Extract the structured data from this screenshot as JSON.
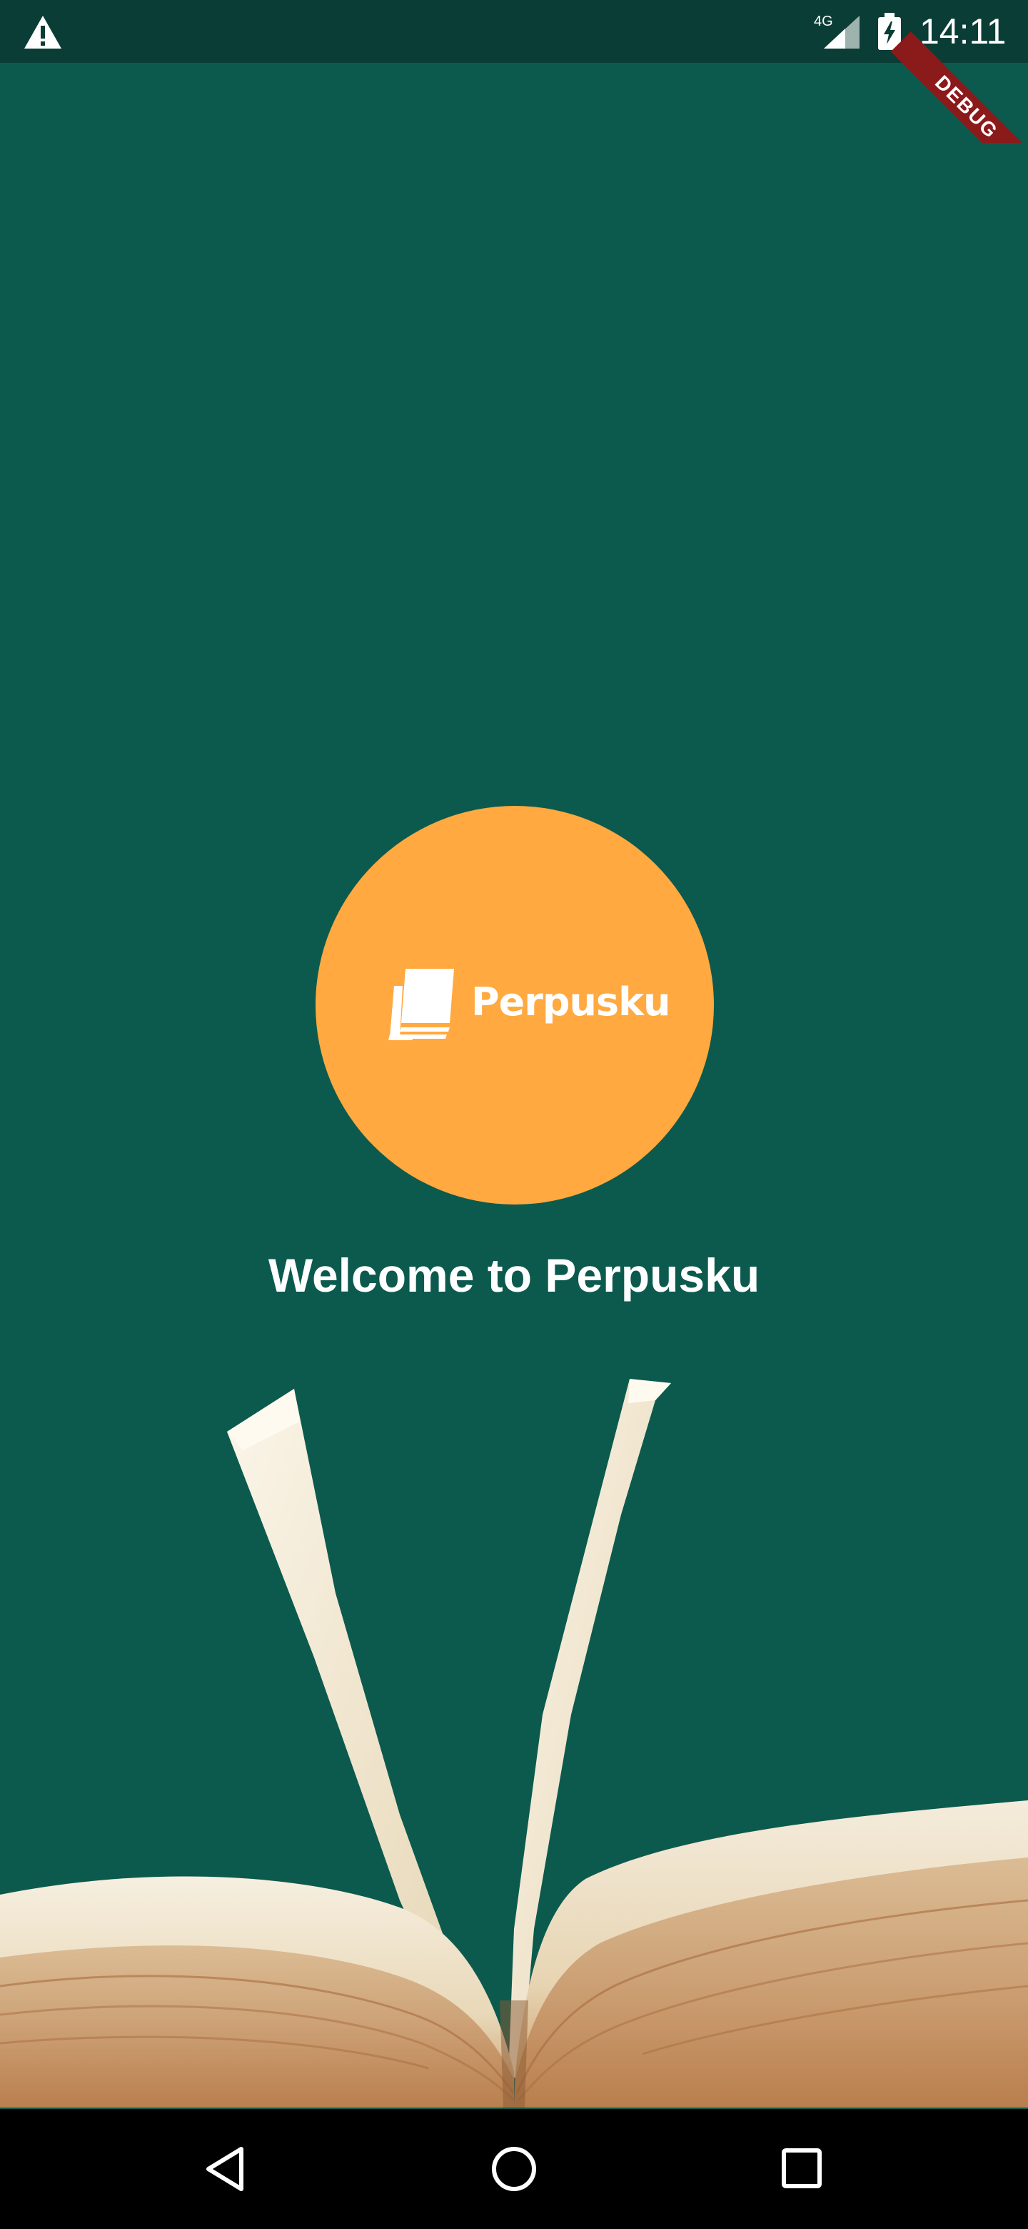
{
  "status_bar": {
    "network": "4G",
    "time": "14:11",
    "debug_label": "DEBUG",
    "icons": [
      "warning-icon",
      "cellular-signal-icon",
      "battery-charging-icon"
    ]
  },
  "logo": {
    "wordmark": "Perpusku",
    "icon": "book-stack-icon",
    "circle_color": "#ffa940"
  },
  "welcome": {
    "title": "Welcome to Perpusku"
  },
  "nav_bar": {
    "icons": [
      "back-icon",
      "home-icon",
      "recents-icon"
    ]
  },
  "colors": {
    "background": "#0c5a4e",
    "status_bar": "#0a3d35",
    "accent": "#ffa940",
    "debug_ribbon": "#8b1a1a"
  }
}
